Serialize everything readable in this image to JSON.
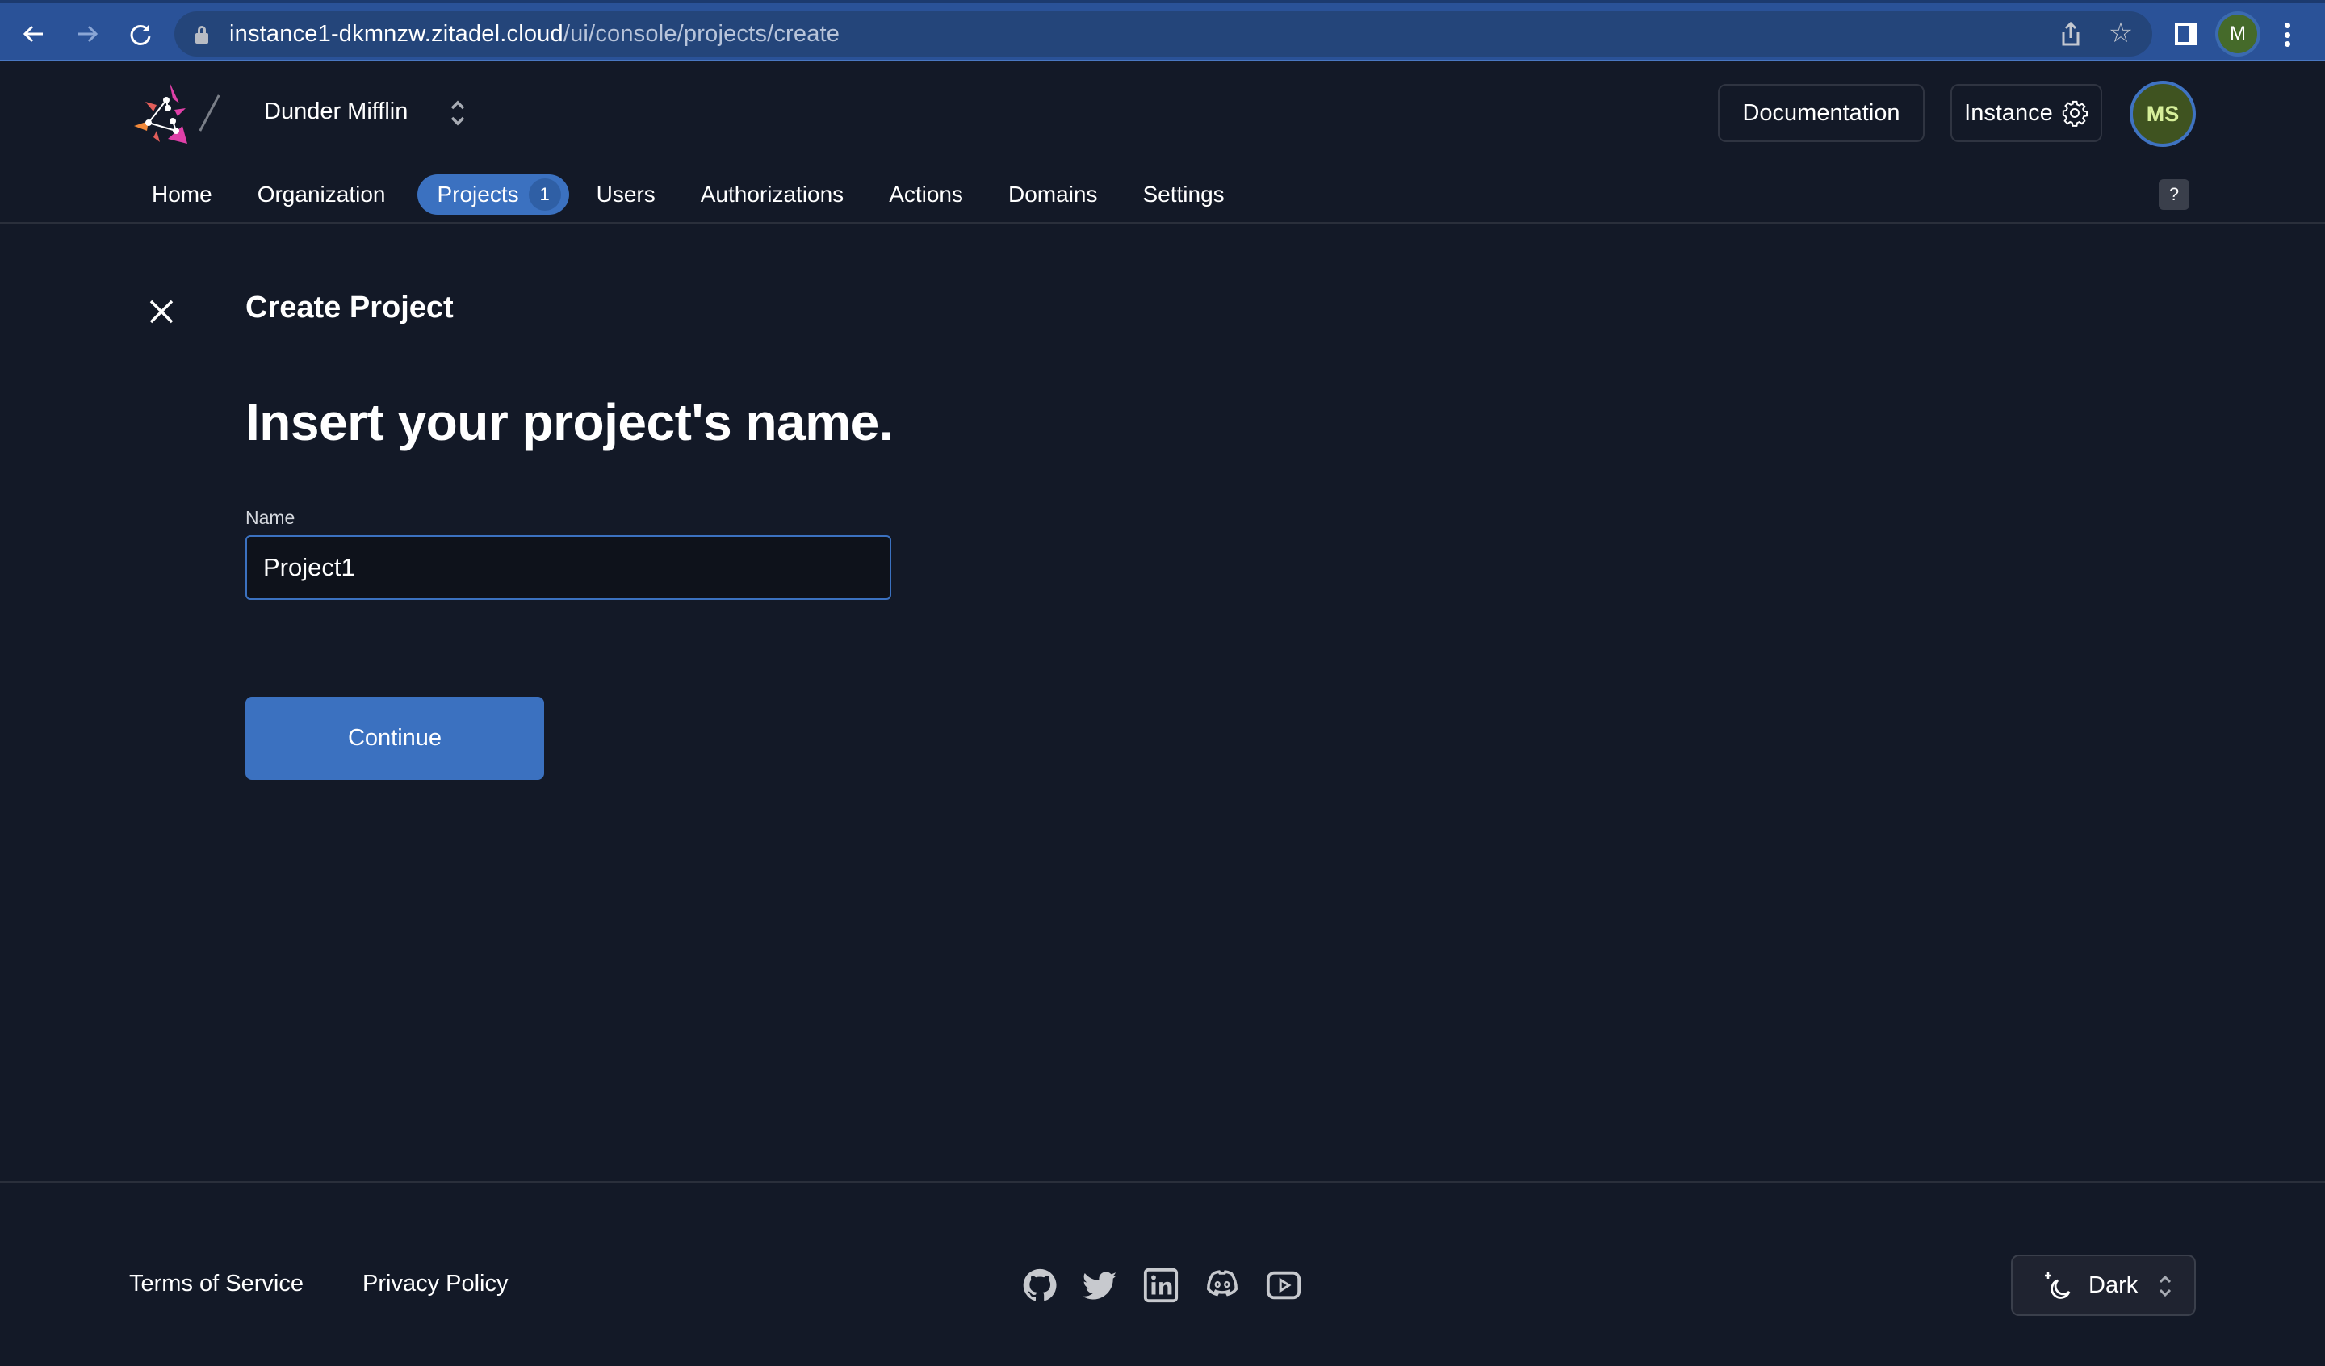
{
  "browser": {
    "url_host": "instance1-dkmnzw.zitadel.cloud",
    "url_path": "/ui/console/projects/create",
    "profile_initial": "M"
  },
  "header": {
    "org_name": "Dunder Mifflin",
    "documentation_label": "Documentation",
    "instance_label": "Instance",
    "avatar_initials": "MS",
    "help_label": "?"
  },
  "nav": {
    "items": [
      {
        "label": "Home"
      },
      {
        "label": "Organization"
      },
      {
        "label": "Projects",
        "badge": "1",
        "active": true
      },
      {
        "label": "Users"
      },
      {
        "label": "Authorizations"
      },
      {
        "label": "Actions"
      },
      {
        "label": "Domains"
      },
      {
        "label": "Settings"
      }
    ]
  },
  "main": {
    "page_title": "Create Project",
    "heading": "Insert your project's name.",
    "name_label": "Name",
    "name_value": "Project1",
    "continue_label": "Continue"
  },
  "footer": {
    "terms_label": "Terms of Service",
    "privacy_label": "Privacy Policy",
    "social_icons": [
      "github-icon",
      "twitter-icon",
      "linkedin-icon",
      "discord-icon",
      "youtube-icon"
    ],
    "theme_label": "Dark"
  },
  "colors": {
    "background": "#131927",
    "accent": "#3b71c0",
    "avatar_bg": "#3f5320",
    "avatar_text": "#d6ef9a"
  }
}
